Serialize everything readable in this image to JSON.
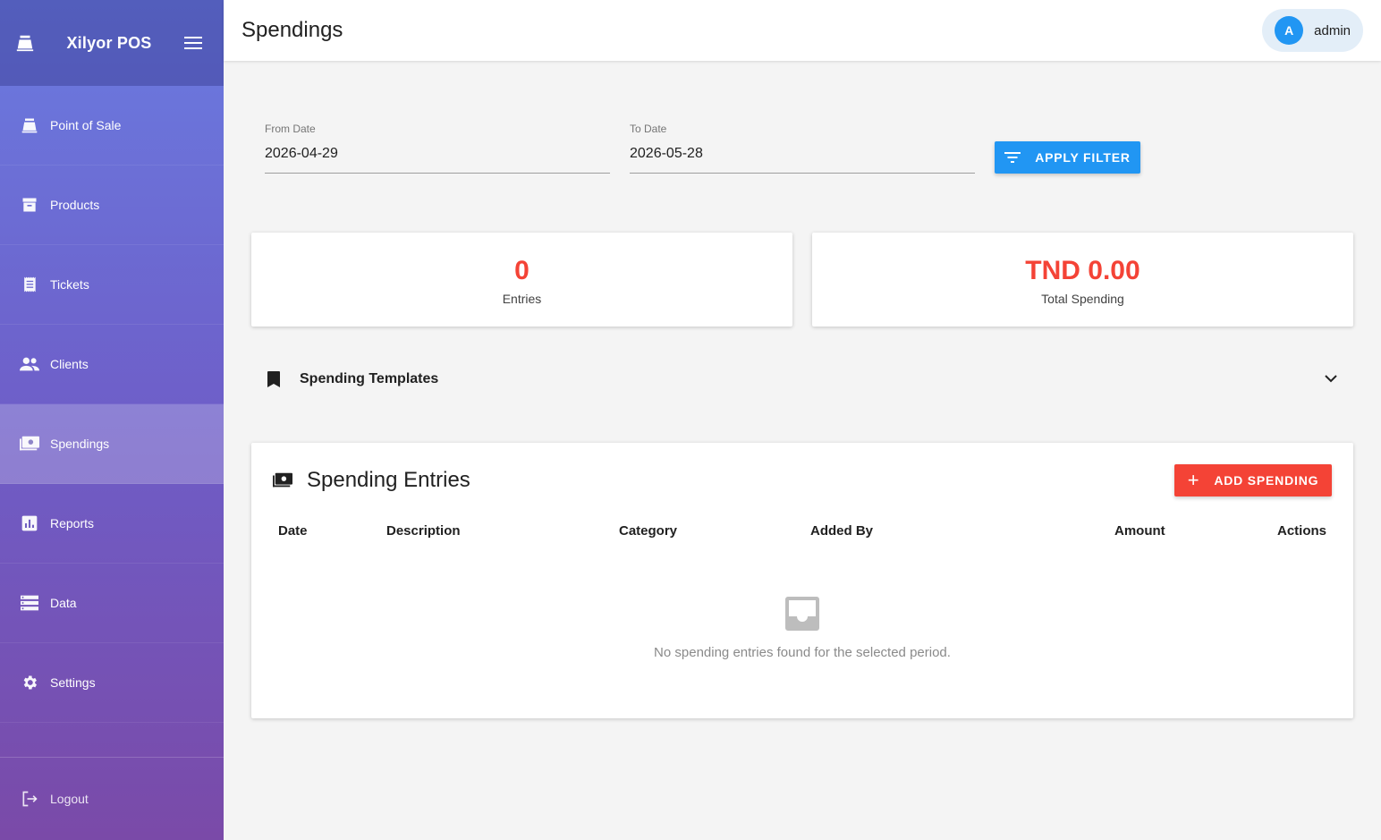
{
  "app": {
    "name": "Xilyor POS"
  },
  "sidebar": {
    "items": [
      {
        "label": "Point of Sale",
        "icon": "cash-register-icon"
      },
      {
        "label": "Products",
        "icon": "archive-box-icon"
      },
      {
        "label": "Tickets",
        "icon": "receipt-icon"
      },
      {
        "label": "Clients",
        "icon": "people-icon"
      },
      {
        "label": "Spendings",
        "icon": "cash-icon",
        "active": true
      },
      {
        "label": "Reports",
        "icon": "bar-chart-icon"
      },
      {
        "label": "Data",
        "icon": "storage-icon"
      },
      {
        "label": "Settings",
        "icon": "gear-icon"
      }
    ],
    "logout": "Logout"
  },
  "header": {
    "title": "Spendings",
    "user": {
      "initial": "A",
      "name": "admin"
    }
  },
  "filter": {
    "from_label": "From Date",
    "from_value": "2026-04-29",
    "to_label": "To Date",
    "to_value": "2026-05-28",
    "apply_label": "APPLY FILTER"
  },
  "stats": {
    "entries": {
      "value": "0",
      "label": "Entries"
    },
    "total": {
      "value": "TND 0.00",
      "label": "Total Spending"
    }
  },
  "templates": {
    "title": "Spending Templates"
  },
  "entries": {
    "title": "Spending Entries",
    "add_label": "ADD SPENDING",
    "columns": [
      "Date",
      "Description",
      "Category",
      "Added By",
      "Amount",
      "Actions"
    ],
    "empty_message": "No spending entries found for the selected period."
  },
  "colors": {
    "primary": "#2196f3",
    "accent": "#f44336",
    "sidebar_top": "#6a7be0",
    "sidebar_bottom": "#7a4aa8"
  }
}
